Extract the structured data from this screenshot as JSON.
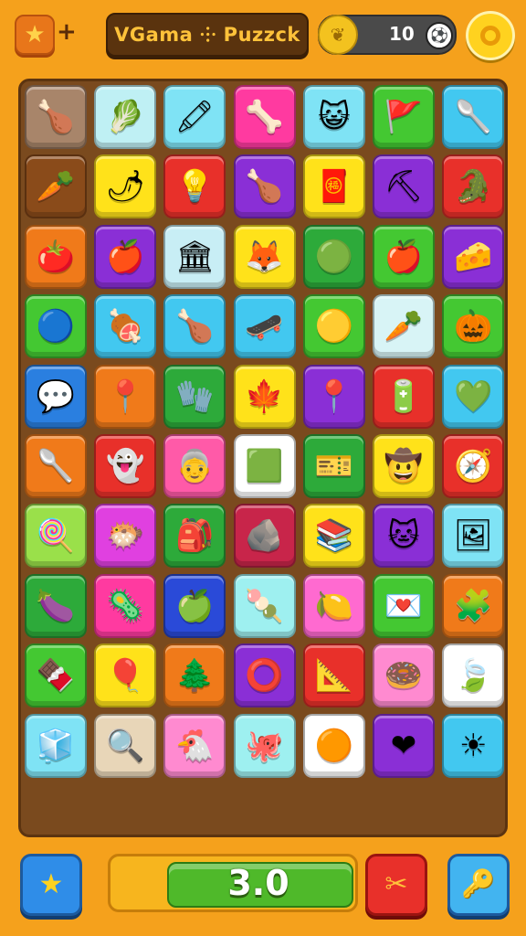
{
  "header": {
    "title": "VGama ⸭ Puzzck",
    "coins": "10",
    "star_icon": "★",
    "plus": "+",
    "coin_icon": "❦",
    "ball_icon": "⚽"
  },
  "board": {
    "tiles": [
      {
        "color": "#a8856a",
        "icon": "🍗"
      },
      {
        "color": "#bff0f4",
        "icon": "🥬"
      },
      {
        "color": "#7fe3f5",
        "icon": "🖍"
      },
      {
        "color": "#ff3aa0",
        "icon": "🦴"
      },
      {
        "color": "#7fe3f5",
        "icon": "😺"
      },
      {
        "color": "#44c832",
        "icon": "🚩"
      },
      {
        "color": "#42c8f0",
        "icon": "🥄"
      },
      {
        "color": "#8a4b1a",
        "icon": "🥕"
      },
      {
        "color": "#ffe21a",
        "icon": "🌶"
      },
      {
        "color": "#e8302a",
        "icon": "💡"
      },
      {
        "color": "#8a2fd6",
        "icon": "🍗"
      },
      {
        "color": "#ffe21a",
        "icon": "🧧"
      },
      {
        "color": "#8a2fd6",
        "icon": "⛏"
      },
      {
        "color": "#e8302a",
        "icon": "🐊"
      },
      {
        "color": "#f07a1a",
        "icon": "🍅"
      },
      {
        "color": "#8a2fd6",
        "icon": "🍎"
      },
      {
        "color": "#c8eef5",
        "icon": "🏛"
      },
      {
        "color": "#ffe21a",
        "icon": "🦊"
      },
      {
        "color": "#2daa3a",
        "icon": "🟢"
      },
      {
        "color": "#44c832",
        "icon": "🍎"
      },
      {
        "color": "#8a2fd6",
        "icon": "🧀"
      },
      {
        "color": "#44c832",
        "icon": "🔵"
      },
      {
        "color": "#42c8f0",
        "icon": "🍖"
      },
      {
        "color": "#42c8f0",
        "icon": "🍗"
      },
      {
        "color": "#42c8f0",
        "icon": "🛹"
      },
      {
        "color": "#44c832",
        "icon": "🟡"
      },
      {
        "color": "#d8f4f6",
        "icon": "🥕"
      },
      {
        "color": "#44c832",
        "icon": "🎃"
      },
      {
        "color": "#2a7fe0",
        "icon": "💬"
      },
      {
        "color": "#f07a1a",
        "icon": "📍"
      },
      {
        "color": "#2daa3a",
        "icon": "🧤"
      },
      {
        "color": "#ffe21a",
        "icon": "🍁"
      },
      {
        "color": "#8a2fd6",
        "icon": "📍"
      },
      {
        "color": "#e8302a",
        "icon": "🔋"
      },
      {
        "color": "#42c8f0",
        "icon": "💚"
      },
      {
        "color": "#f07a1a",
        "icon": "🥄"
      },
      {
        "color": "#e8302a",
        "icon": "👻"
      },
      {
        "color": "#ff5aa8",
        "icon": "👵"
      },
      {
        "color": "#ffffff",
        "icon": "🟩"
      },
      {
        "color": "#2daa3a",
        "icon": "🎫"
      },
      {
        "color": "#ffe21a",
        "icon": "🤠"
      },
      {
        "color": "#e8302a",
        "icon": "🧭"
      },
      {
        "color": "#9ae04a",
        "icon": "🍭"
      },
      {
        "color": "#e040e0",
        "icon": "🐡"
      },
      {
        "color": "#2daa3a",
        "icon": "🎒"
      },
      {
        "color": "#c8254a",
        "icon": "🪨"
      },
      {
        "color": "#ffe21a",
        "icon": "📚"
      },
      {
        "color": "#8a2fd6",
        "icon": "🐱"
      },
      {
        "color": "#7fe3f5",
        "icon": "🖼"
      },
      {
        "color": "#2daa3a",
        "icon": "🍆"
      },
      {
        "color": "#ff3aa0",
        "icon": "🦠"
      },
      {
        "color": "#2a4ad8",
        "icon": "🍏"
      },
      {
        "color": "#9ef0f0",
        "icon": "🍡"
      },
      {
        "color": "#ff6ad0",
        "icon": "🍋"
      },
      {
        "color": "#44c832",
        "icon": "💌"
      },
      {
        "color": "#f07a1a",
        "icon": "🧩"
      },
      {
        "color": "#44c832",
        "icon": "🍫"
      },
      {
        "color": "#ffe21a",
        "icon": "🎈"
      },
      {
        "color": "#f07a1a",
        "icon": "🌲"
      },
      {
        "color": "#8a2fd6",
        "icon": "⭕"
      },
      {
        "color": "#e8302a",
        "icon": "📐"
      },
      {
        "color": "#ff8ad0",
        "icon": "🍩"
      },
      {
        "color": "#ffffff",
        "icon": "🍃"
      },
      {
        "color": "#7fe3f5",
        "icon": "🧊"
      },
      {
        "color": "#e8d6b8",
        "icon": "🔍"
      },
      {
        "color": "#ff8ad0",
        "icon": "🐔"
      },
      {
        "color": "#9ef0f0",
        "icon": "🐙"
      },
      {
        "color": "#ffffff",
        "icon": "🟠"
      },
      {
        "color": "#8a2fd6",
        "icon": "❤"
      },
      {
        "color": "#42c8f0",
        "icon": "☀"
      }
    ]
  },
  "footer": {
    "star_button_icon": "★",
    "score": "3.0",
    "tool_button_icon": "✂",
    "key_button_icon": "🔑"
  }
}
